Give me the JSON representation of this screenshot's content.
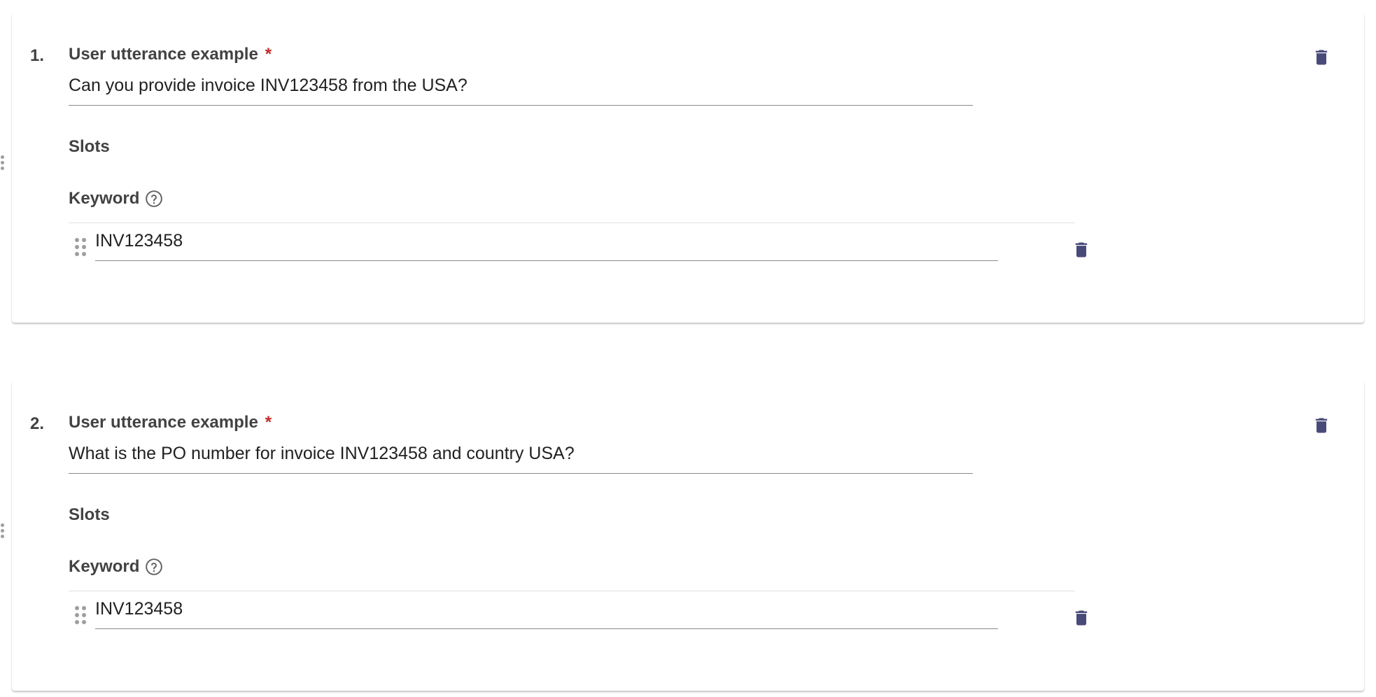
{
  "colors": {
    "icon": "#4a4a7a",
    "required": "#c62828",
    "label": "#424242"
  },
  "examples": [
    {
      "index": "1.",
      "label": "User utterance example",
      "required_mark": "*",
      "utterance": "Can you provide invoice INV123458 from the USA?",
      "slots_title": "Slots",
      "keyword_title": "Keyword",
      "keyword_value": "INV123458",
      "icons": [
        "delete-icon",
        "help-icon",
        "drag-handle-icon"
      ]
    },
    {
      "index": "2.",
      "label": "User utterance example",
      "required_mark": "*",
      "utterance": "What is the PO number for invoice INV123458 and country USA?",
      "slots_title": "Slots",
      "keyword_title": "Keyword",
      "keyword_value": "INV123458",
      "icons": [
        "delete-icon",
        "help-icon",
        "drag-handle-icon"
      ]
    }
  ]
}
